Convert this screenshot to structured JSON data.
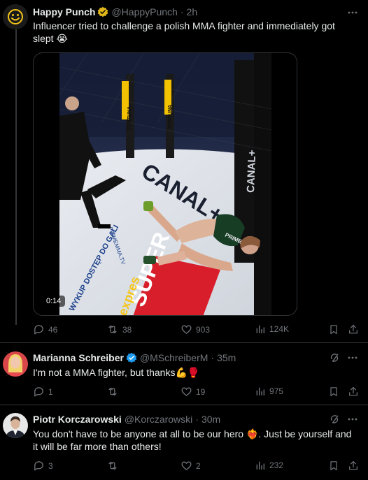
{
  "posts": [
    {
      "name": "Happy Punch",
      "handle": "@HappyPunch",
      "time": "2h",
      "text": "Influencer tried to challenge a polish MMA fighter and immediately got slept 😭",
      "video_duration": "0:14",
      "video_overlay": {
        "broadcaster": "CANAL+",
        "sponsor": "FORTUNA",
        "promo": "WYKUP DOSTĘP DO GALI",
        "super": "SUPER",
        "expres": "expres",
        "prime": "PRIME",
        "prime_site": "PRIMEMMA.TV"
      },
      "stats": {
        "replies": "46",
        "reposts": "38",
        "likes": "903",
        "views": "124K"
      }
    },
    {
      "name": "Marianna Schreiber",
      "handle": "@MSchreiberM",
      "time": "35m",
      "text": "I'm not a MMA fighter, but thanks💪🥊",
      "stats": {
        "replies": "1",
        "reposts": "",
        "likes": "19",
        "views": "975"
      }
    },
    {
      "name": "Piotr Korczarowski",
      "handle": "@Korczarowski",
      "time": "30m",
      "text": "You don't have to be anyone at all to be our hero ❤️‍🔥. Just be yourself and it will be far more than others!",
      "stats": {
        "replies": "3",
        "reposts": "",
        "likes": "2",
        "views": "232"
      }
    }
  ],
  "separator": "·",
  "colors": {
    "background": "#000000",
    "text": "#e7e9ea",
    "muted": "#71767b",
    "verified_gold": "#e2b719",
    "verified_blue": "#1d9bf0",
    "border": "#2f3336"
  },
  "icons": [
    "smiley-avatar-icon",
    "verified-gold-icon",
    "verified-blue-icon",
    "more-icon",
    "grok-icon",
    "reply-icon",
    "repost-icon",
    "like-icon",
    "views-icon",
    "bookmark-icon",
    "share-icon"
  ]
}
